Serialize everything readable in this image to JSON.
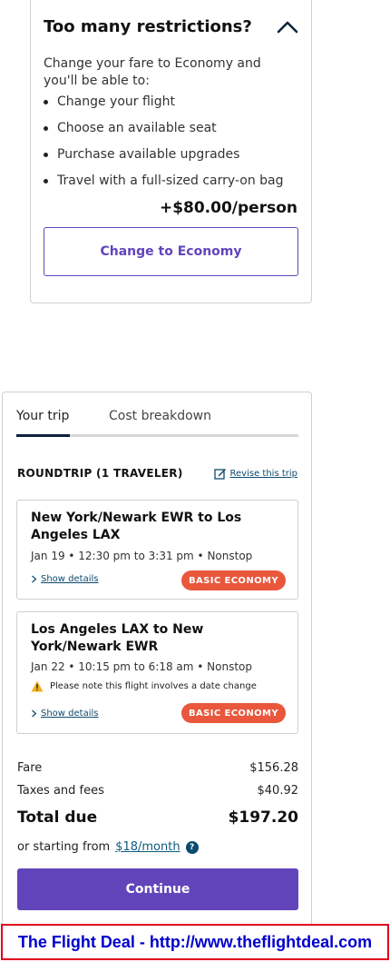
{
  "restrictions": {
    "title": "Too many restrictions?",
    "intro": "Change your fare to Economy and you'll be able to:",
    "benefits": [
      "Change your flight",
      "Choose an available seat",
      "Purchase available upgrades",
      "Travel with a full-sized carry-on bag"
    ],
    "price": "+$80.00/person",
    "button_label": "Change to Economy",
    "icon": "chevron-up-icon"
  },
  "trip": {
    "tabs": [
      {
        "label": "Your trip",
        "active": true
      },
      {
        "label": "Cost breakdown",
        "active": false
      }
    ],
    "roundtrip_label": "ROUNDTRIP (1 TRAVELER)",
    "revise_label": "Revise this trip",
    "segments": [
      {
        "route": "New York/Newark EWR to Los Angeles LAX",
        "time": "Jan 19 • 12:30 pm to 3:31 pm • Nonstop",
        "warning": "",
        "details_label": "Show details",
        "fare_badge": "BASIC ECONOMY"
      },
      {
        "route": "Los Angeles LAX to New York/Newark EWR",
        "time": "Jan 22 • 10:15 pm to 6:18 am • Nonstop",
        "warning": "Please note this flight involves a date change",
        "details_label": "Show details",
        "fare_badge": "BASIC ECONOMY"
      }
    ],
    "costs": {
      "fare_label": "Fare",
      "fare_value": "$156.28",
      "taxes_label": "Taxes and fees",
      "taxes_value": "$40.92",
      "total_label": "Total due",
      "total_value": "$197.20"
    },
    "monthly_prefix": "or starting from",
    "monthly_link": "$18/month",
    "help_glyph": "?",
    "continue_label": "Continue"
  },
  "banner": {
    "text": "The Flight Deal - http://www.theflightdeal.com"
  },
  "colors": {
    "accent": "#6244bb",
    "badge": "#e9573c",
    "link": "#0c4a6e",
    "tab_underline": "#0c2340",
    "banner_text": "#0000cc",
    "banner_border": "#e0001b"
  }
}
